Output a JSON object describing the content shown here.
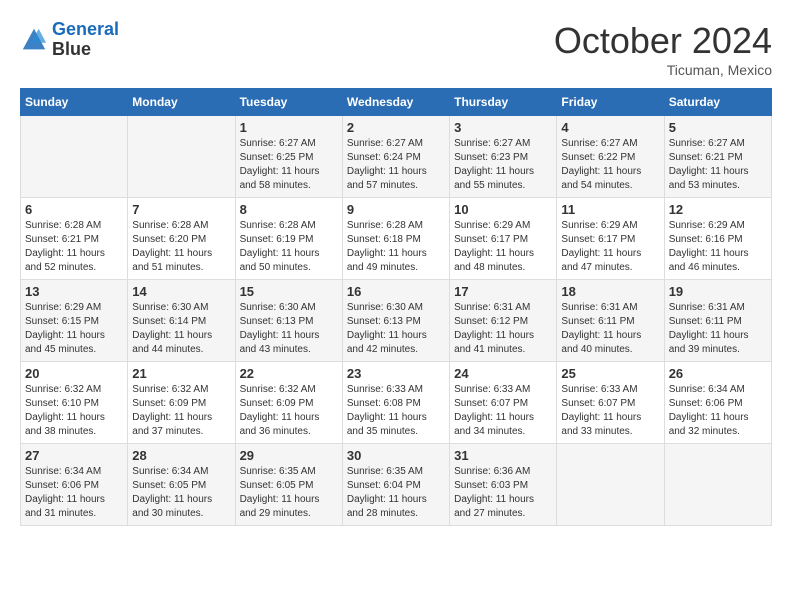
{
  "header": {
    "logo_line1": "General",
    "logo_line2": "Blue",
    "month_title": "October 2024",
    "location": "Ticuman, Mexico"
  },
  "weekdays": [
    "Sunday",
    "Monday",
    "Tuesday",
    "Wednesday",
    "Thursday",
    "Friday",
    "Saturday"
  ],
  "weeks": [
    [
      {
        "day": "",
        "info": ""
      },
      {
        "day": "",
        "info": ""
      },
      {
        "day": "1",
        "info": "Sunrise: 6:27 AM\nSunset: 6:25 PM\nDaylight: 11 hours and 58 minutes."
      },
      {
        "day": "2",
        "info": "Sunrise: 6:27 AM\nSunset: 6:24 PM\nDaylight: 11 hours and 57 minutes."
      },
      {
        "day": "3",
        "info": "Sunrise: 6:27 AM\nSunset: 6:23 PM\nDaylight: 11 hours and 55 minutes."
      },
      {
        "day": "4",
        "info": "Sunrise: 6:27 AM\nSunset: 6:22 PM\nDaylight: 11 hours and 54 minutes."
      },
      {
        "day": "5",
        "info": "Sunrise: 6:27 AM\nSunset: 6:21 PM\nDaylight: 11 hours and 53 minutes."
      }
    ],
    [
      {
        "day": "6",
        "info": "Sunrise: 6:28 AM\nSunset: 6:21 PM\nDaylight: 11 hours and 52 minutes."
      },
      {
        "day": "7",
        "info": "Sunrise: 6:28 AM\nSunset: 6:20 PM\nDaylight: 11 hours and 51 minutes."
      },
      {
        "day": "8",
        "info": "Sunrise: 6:28 AM\nSunset: 6:19 PM\nDaylight: 11 hours and 50 minutes."
      },
      {
        "day": "9",
        "info": "Sunrise: 6:28 AM\nSunset: 6:18 PM\nDaylight: 11 hours and 49 minutes."
      },
      {
        "day": "10",
        "info": "Sunrise: 6:29 AM\nSunset: 6:17 PM\nDaylight: 11 hours and 48 minutes."
      },
      {
        "day": "11",
        "info": "Sunrise: 6:29 AM\nSunset: 6:17 PM\nDaylight: 11 hours and 47 minutes."
      },
      {
        "day": "12",
        "info": "Sunrise: 6:29 AM\nSunset: 6:16 PM\nDaylight: 11 hours and 46 minutes."
      }
    ],
    [
      {
        "day": "13",
        "info": "Sunrise: 6:29 AM\nSunset: 6:15 PM\nDaylight: 11 hours and 45 minutes."
      },
      {
        "day": "14",
        "info": "Sunrise: 6:30 AM\nSunset: 6:14 PM\nDaylight: 11 hours and 44 minutes."
      },
      {
        "day": "15",
        "info": "Sunrise: 6:30 AM\nSunset: 6:13 PM\nDaylight: 11 hours and 43 minutes."
      },
      {
        "day": "16",
        "info": "Sunrise: 6:30 AM\nSunset: 6:13 PM\nDaylight: 11 hours and 42 minutes."
      },
      {
        "day": "17",
        "info": "Sunrise: 6:31 AM\nSunset: 6:12 PM\nDaylight: 11 hours and 41 minutes."
      },
      {
        "day": "18",
        "info": "Sunrise: 6:31 AM\nSunset: 6:11 PM\nDaylight: 11 hours and 40 minutes."
      },
      {
        "day": "19",
        "info": "Sunrise: 6:31 AM\nSunset: 6:11 PM\nDaylight: 11 hours and 39 minutes."
      }
    ],
    [
      {
        "day": "20",
        "info": "Sunrise: 6:32 AM\nSunset: 6:10 PM\nDaylight: 11 hours and 38 minutes."
      },
      {
        "day": "21",
        "info": "Sunrise: 6:32 AM\nSunset: 6:09 PM\nDaylight: 11 hours and 37 minutes."
      },
      {
        "day": "22",
        "info": "Sunrise: 6:32 AM\nSunset: 6:09 PM\nDaylight: 11 hours and 36 minutes."
      },
      {
        "day": "23",
        "info": "Sunrise: 6:33 AM\nSunset: 6:08 PM\nDaylight: 11 hours and 35 minutes."
      },
      {
        "day": "24",
        "info": "Sunrise: 6:33 AM\nSunset: 6:07 PM\nDaylight: 11 hours and 34 minutes."
      },
      {
        "day": "25",
        "info": "Sunrise: 6:33 AM\nSunset: 6:07 PM\nDaylight: 11 hours and 33 minutes."
      },
      {
        "day": "26",
        "info": "Sunrise: 6:34 AM\nSunset: 6:06 PM\nDaylight: 11 hours and 32 minutes."
      }
    ],
    [
      {
        "day": "27",
        "info": "Sunrise: 6:34 AM\nSunset: 6:06 PM\nDaylight: 11 hours and 31 minutes."
      },
      {
        "day": "28",
        "info": "Sunrise: 6:34 AM\nSunset: 6:05 PM\nDaylight: 11 hours and 30 minutes."
      },
      {
        "day": "29",
        "info": "Sunrise: 6:35 AM\nSunset: 6:05 PM\nDaylight: 11 hours and 29 minutes."
      },
      {
        "day": "30",
        "info": "Sunrise: 6:35 AM\nSunset: 6:04 PM\nDaylight: 11 hours and 28 minutes."
      },
      {
        "day": "31",
        "info": "Sunrise: 6:36 AM\nSunset: 6:03 PM\nDaylight: 11 hours and 27 minutes."
      },
      {
        "day": "",
        "info": ""
      },
      {
        "day": "",
        "info": ""
      }
    ]
  ]
}
